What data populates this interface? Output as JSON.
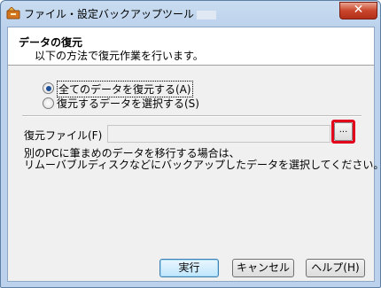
{
  "window": {
    "title": "ファイル・設定バックアップツール",
    "close_glyph": "✕"
  },
  "header": {
    "title": "データの復元",
    "subtitle": "以下の方法で復元作業を行います。"
  },
  "restore_options": [
    {
      "label": "全てのデータを復元する(A)",
      "selected": true
    },
    {
      "label": "復元するデータを選択する(S)",
      "selected": false
    }
  ],
  "restore_file": {
    "label": "復元ファイル(F)",
    "value": "",
    "browse_label": "..."
  },
  "note": {
    "line1": "別のPCに筆まめのデータを移行する場合は、",
    "line2": "リムーバブルディスクなどにバックアップしたデータを選択してください。"
  },
  "buttons": {
    "execute": "実行",
    "cancel": "キャンセル",
    "help": "ヘルプ(H)"
  },
  "colors": {
    "highlight": "#e2001b",
    "radio_dot": "#1f4f96"
  }
}
